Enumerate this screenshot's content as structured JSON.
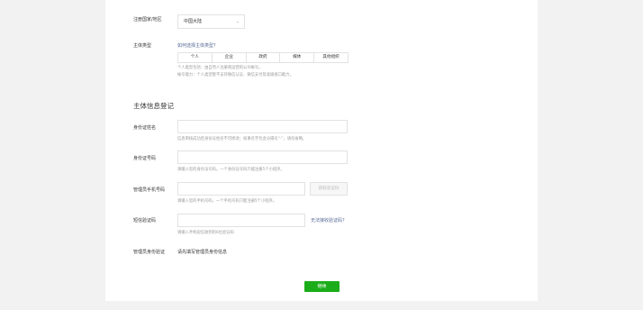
{
  "region": {
    "label": "注册国家/地区",
    "selected": "中国大陆"
  },
  "entity_type": {
    "label": "主体类型",
    "help_link": "如何选择主体类型？",
    "options": [
      "个人",
      "企业",
      "政府",
      "媒体",
      "其他组织"
    ],
    "hint1": "个人类型包括：由自然人注册和运营的公众帐号。",
    "hint2": "帐号能力：个人类型暂不支持微信认证、微信支付及高级接口能力。"
  },
  "section": {
    "title": "主体信息登记"
  },
  "id_name": {
    "label": "身份证姓名",
    "hint": "信息审核成功后身份证姓名不可修改；如果名字包含分隔号“·”，请勿省略。"
  },
  "id_number": {
    "label": "身份证号码",
    "hint": "请输入您的身份证号码。一个身份证号码只能注册5个小程序。"
  },
  "phone": {
    "label": "管理员手机号码",
    "button": "获取验证码",
    "hint": "请输入您的手机号码，一个手机号码只能注册5个小程序。"
  },
  "sms": {
    "label": "短信验证码",
    "link": "无法接收验证码？",
    "hint": "请输入手机短信收到的6位验证码"
  },
  "identity": {
    "label": "管理员身份验证",
    "value": "请先填写管理员身份信息"
  },
  "submit": {
    "label": "继续"
  },
  "colors": {
    "primary": "#1aad19",
    "link": "#576b95"
  }
}
